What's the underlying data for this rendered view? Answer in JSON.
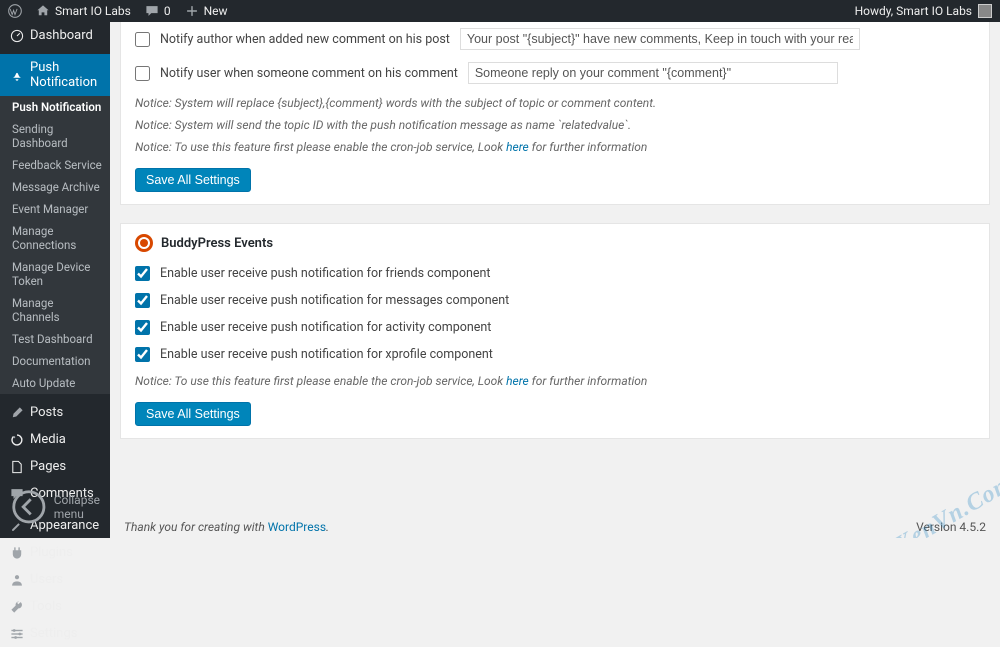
{
  "adminbar": {
    "site": "Smart IO Labs",
    "comments": "0",
    "new": "New",
    "howdy": "Howdy, Smart IO Labs"
  },
  "menu": {
    "dashboard": "Dashboard",
    "pushnotif": "Push Notification",
    "sub": [
      "Push Notification",
      "Sending Dashboard",
      "Feedback Service",
      "Message Archive",
      "Event Manager",
      "Manage Connections",
      "Manage Device Token",
      "Manage Channels",
      "Test Dashboard",
      "Documentation",
      "Auto Update"
    ],
    "posts": "Posts",
    "media": "Media",
    "pages": "Pages",
    "comments": "Comments",
    "appearance": "Appearance",
    "plugins": "Plugins",
    "users": "Users",
    "tools": "Tools",
    "settings": "Settings",
    "collapse": "Collapse menu"
  },
  "panel1": {
    "chk1_label": "Notify author when added new comment on his post",
    "chk1_value": "Your post \"{subject}\" have new comments, Keep in touch with your readers",
    "chk2_label": "Notify user when someone comment on his comment",
    "chk2_value": "Someone reply on your comment \"{comment}\"",
    "notice1": "Notice: System will replace {subject},{comment} words with the subject of topic or comment content.",
    "notice2": "Notice: System will send the topic ID with the push notification message as name `relatedvalue`.",
    "notice3_a": "Notice: To use this feature first please enable the cron-job service, Look ",
    "notice3_link": "here",
    "notice3_b": " for further information",
    "save": "Save All Settings"
  },
  "panel2": {
    "title": "BuddyPress Events",
    "chk1": "Enable user receive push notification for friends component",
    "chk2": "Enable user receive push notification for messages component",
    "chk3": "Enable user receive push notification for activity component",
    "chk4": "Enable user receive push notification for xprofile component",
    "notice_a": "Notice: To use this feature first please enable the cron-job service, Look ",
    "notice_link": "here",
    "notice_b": " for further information",
    "save": "Save All Settings"
  },
  "footer": {
    "thank_a": "Thank you for creating with ",
    "thank_link": "WordPress",
    "thank_b": ".",
    "version": "Version 4.5.2"
  },
  "watermark": "XenVn.Com"
}
